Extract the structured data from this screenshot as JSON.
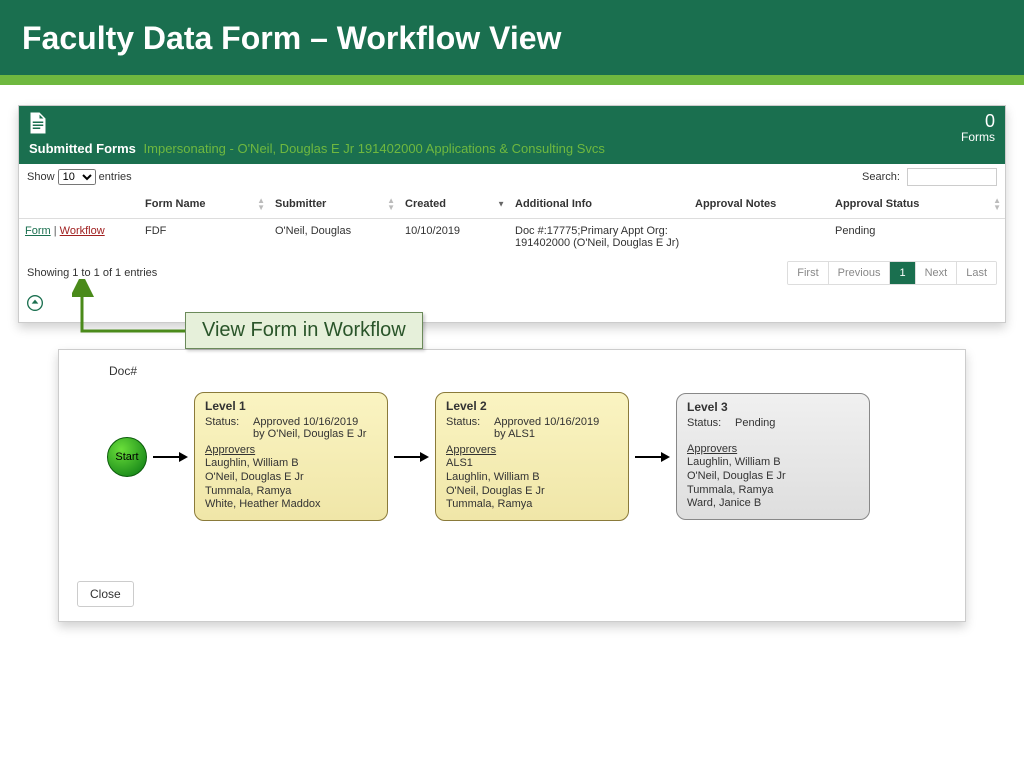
{
  "page": {
    "title": "Faculty Data Form – Workflow View"
  },
  "panel_header": {
    "title": "Submitted Forms",
    "impersonating": "Impersonating - O'Neil, Douglas E Jr 191402000 Applications & Consulting Svcs",
    "count": "0",
    "count_label": "Forms"
  },
  "controls": {
    "show_prefix": "Show",
    "show_value": "10",
    "show_suffix": "entries",
    "search_label": "Search:"
  },
  "columns": {
    "c0": "",
    "c1": "Form Name",
    "c2": "Submitter",
    "c3": "Created",
    "c4": "Additional Info",
    "c5": "Approval Notes",
    "c6": "Approval Status"
  },
  "row": {
    "form_link": "Form",
    "sep": " | ",
    "workflow_link": "Workflow",
    "form_name": "FDF",
    "submitter": "O'Neil, Douglas",
    "created": "10/10/2019",
    "addl_line1": "Doc #:17775;Primary Appt Org:",
    "addl_line2": "191402000 (O'Neil, Douglas E Jr)",
    "approval_notes": "",
    "approval_status": "Pending"
  },
  "showing": "Showing 1 to 1 of 1 entries",
  "pager": {
    "first": "First",
    "prev": "Previous",
    "page": "1",
    "next": "Next",
    "last": "Last"
  },
  "callout": "View Form in Workflow",
  "workflow": {
    "doc_label": "Doc#",
    "start": "Start",
    "close": "Close",
    "level1": {
      "title": "Level 1",
      "status_lbl": "Status:",
      "status_val": "Approved 10/16/2019",
      "by": "by O'Neil, Douglas E Jr",
      "appr_h": "Approvers",
      "a1": "Laughlin, William B",
      "a2": "O'Neil, Douglas E Jr",
      "a3": "Tummala, Ramya",
      "a4": "White, Heather Maddox"
    },
    "level2": {
      "title": "Level 2",
      "status_lbl": "Status:",
      "status_val": "Approved 10/16/2019",
      "by": "by ALS1",
      "appr_h": "Approvers",
      "a1": "ALS1",
      "a2": "Laughlin, William B",
      "a3": "O'Neil, Douglas E Jr",
      "a4": "Tummala, Ramya"
    },
    "level3": {
      "title": "Level 3",
      "status_lbl": "Status:",
      "status_val": "Pending",
      "appr_h": "Approvers",
      "a1": "Laughlin, William B",
      "a2": "O'Neil, Douglas E Jr",
      "a3": "Tummala, Ramya",
      "a4": "Ward, Janice B"
    }
  }
}
